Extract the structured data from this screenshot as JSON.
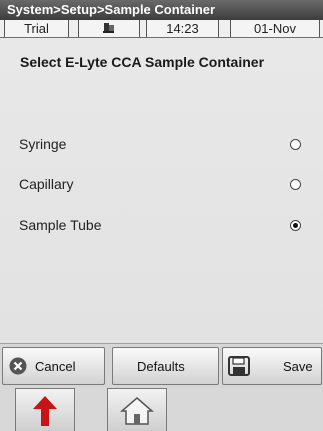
{
  "title_bar": {
    "breadcrumb": "System>Setup>Sample Container"
  },
  "status_bar": {
    "mode": "Trial",
    "device_icon": "analyzer-icon",
    "time": "14:23",
    "date": "01-Nov"
  },
  "main": {
    "heading": "Select E-Lyte CCA Sample Container",
    "options": [
      {
        "label": "Syringe",
        "selected": false
      },
      {
        "label": "Capillary",
        "selected": false
      },
      {
        "label": "Sample Tube",
        "selected": true
      }
    ]
  },
  "actions": {
    "cancel_label": "Cancel",
    "cancel_icon": "close-circle-icon",
    "defaults_label": "Defaults",
    "save_label": "Save",
    "save_icon": "floppy-disk-icon"
  },
  "nav": {
    "back_icon": "up-arrow-icon",
    "home_icon": "home-icon"
  },
  "colors": {
    "title_bar": "#3c3c3c",
    "background": "#e4e4e4",
    "arrow": "#c81414"
  }
}
